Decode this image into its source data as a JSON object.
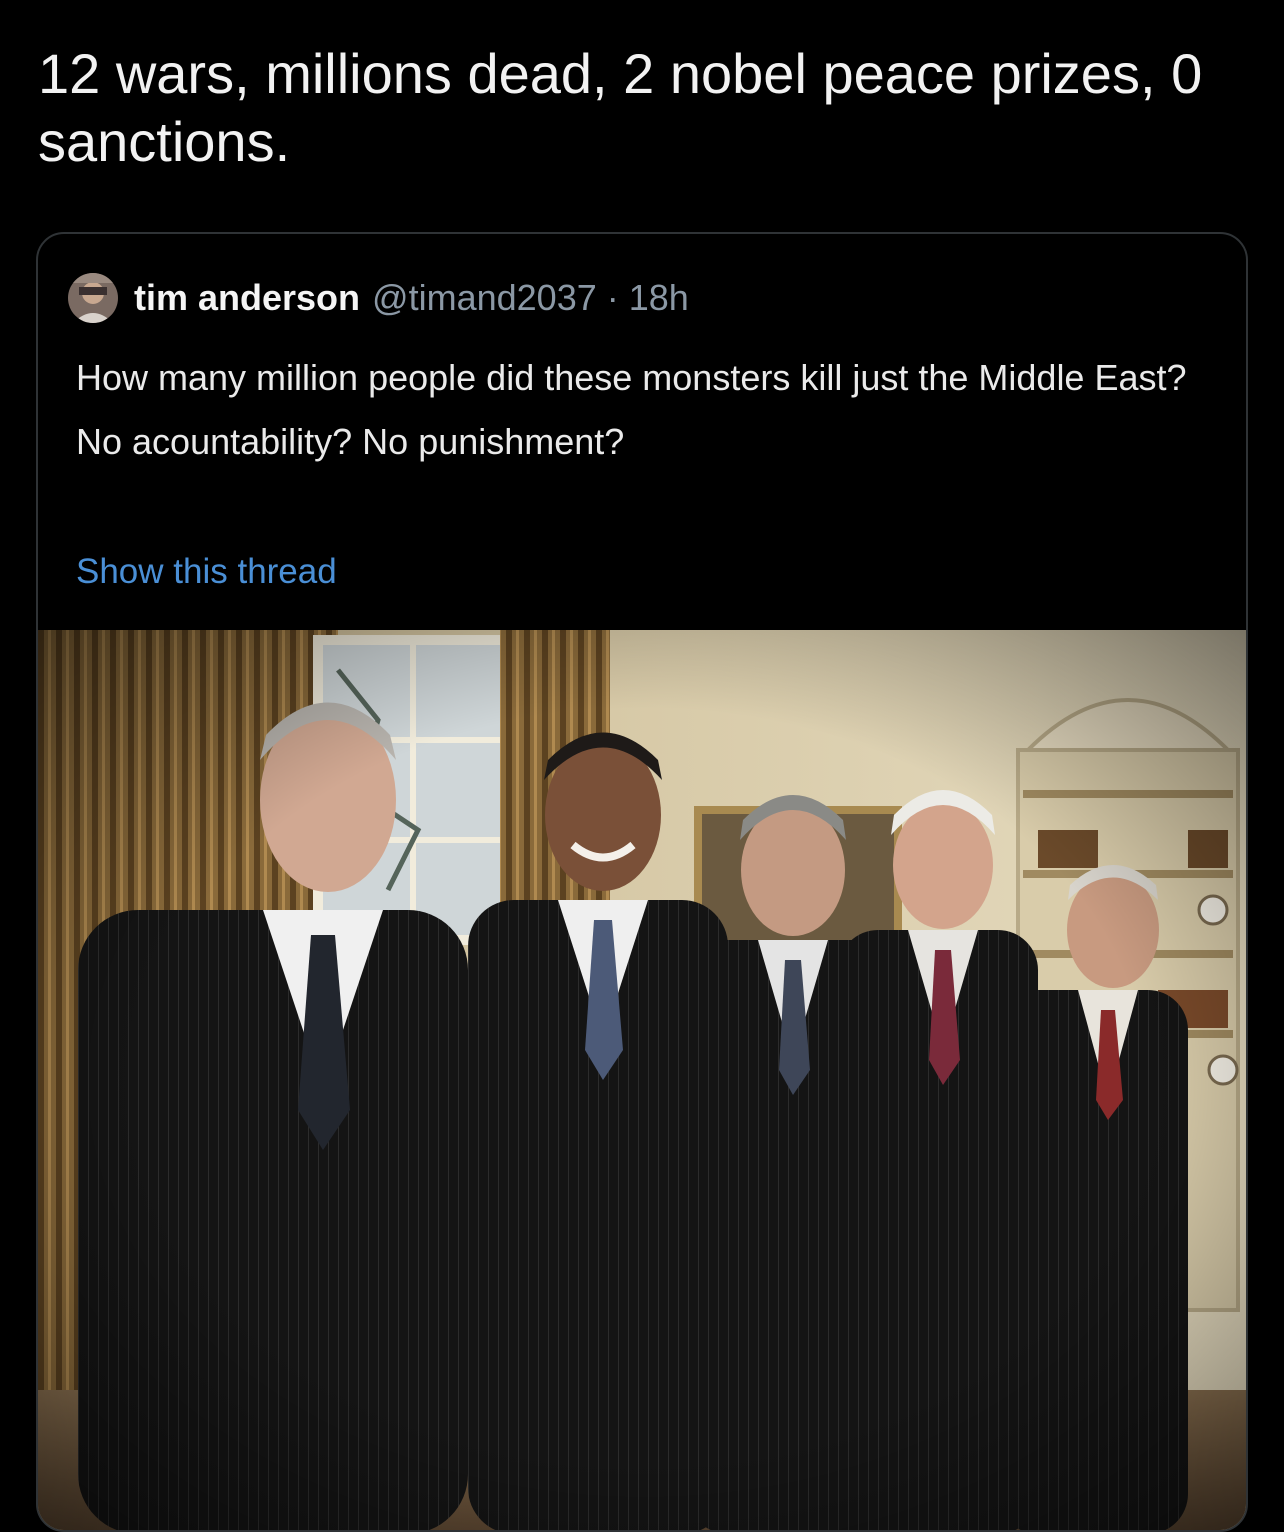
{
  "post": {
    "text": "12 wars, millions dead, 2 nobel peace prizes, 0 sanctions."
  },
  "quoted_tweet": {
    "author_name": "tim anderson",
    "author_handle": "@timand2037",
    "separator": "·",
    "timestamp": "18h",
    "body": "How many million people did these monsters kill just the Middle East? No acountability? No punishment?",
    "show_thread_label": "Show this thread",
    "avatar_icon": "avatar-photo",
    "link_color": "#4a8fd6"
  }
}
